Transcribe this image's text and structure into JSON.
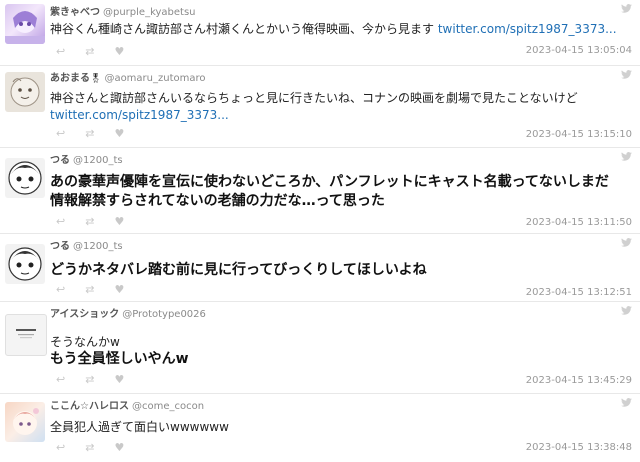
{
  "tweets": [
    {
      "name": "紫きゃべつ",
      "handle": "@purple_kyabetsu",
      "lines": [
        "神谷くん種崎さん諏訪部さん村瀬くんとかいう俺得映画、今から見ます"
      ],
      "link": "twitter.com/spitz1987_3373...",
      "timestamp": "2023-04-15 13:05:04"
    },
    {
      "name": "あおまる",
      "badge": "🎖",
      "handle": "@aomaru_zutomaro",
      "lines": [
        "神谷さんと諏訪部さんいるならちょっと見に行きたいね、コナンの映画を劇場で見たことないけど"
      ],
      "link": "twitter.com/spitz1987_3373...",
      "timestamp": "2023-04-15 13:15:10"
    },
    {
      "name": "つる",
      "handle": "@1200_ts",
      "lines": [
        "あの豪華声優陣を宣伝に使わないどころか、パンフレットにキャスト名載ってないしまだ",
        "情報解禁すらされてないの老舗の力だな…って思った"
      ],
      "timestamp": "2023-04-15 13:11:50"
    },
    {
      "name": "つる",
      "handle": "@1200_ts",
      "lines": [
        "どうかネタバレ踏む前に見に行ってびっくりしてほしいよね"
      ],
      "timestamp": "2023-04-15 13:12:51"
    },
    {
      "name": "アイスショック",
      "handle": "@Prototype0026",
      "lines": [
        "そうなんかw"
      ],
      "lines_big": [
        "もう全員怪しいやんw"
      ],
      "timestamp": "2023-04-15 13:45:29"
    },
    {
      "name": "ここん☆ハレロス",
      "handle": "@come_cocon",
      "lines": [
        "全員犯人過ぎて面白いwwwwww"
      ],
      "timestamp": "2023-04-15 13:38:48"
    }
  ],
  "icons": {
    "reply": "reply-icon",
    "retweet": "retweet-icon",
    "like": "heart-icon",
    "source": "twitter-bird-icon"
  },
  "colors": {
    "link": "#1f6fb5",
    "timestamp": "#9a9a9a",
    "divider": "#e8e8e8"
  }
}
